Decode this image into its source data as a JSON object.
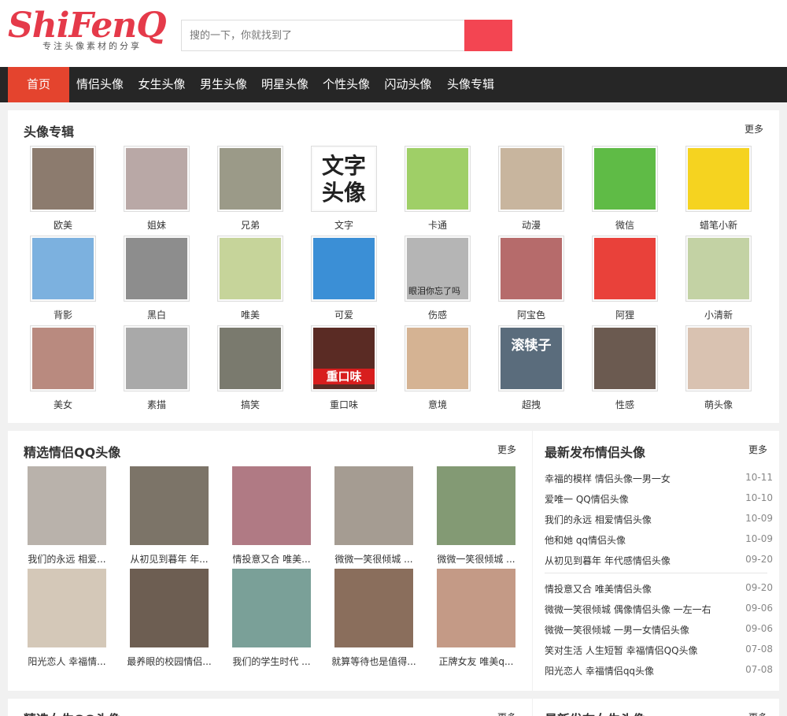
{
  "logo": {
    "text": "ShiFenQ",
    "tagline": "专注头像素材的分享"
  },
  "search": {
    "placeholder": "搜的一下，你就找到了"
  },
  "nav": [
    {
      "label": "首页",
      "active": true
    },
    {
      "label": "情侣头像"
    },
    {
      "label": "女生头像"
    },
    {
      "label": "男生头像"
    },
    {
      "label": "明星头像"
    },
    {
      "label": "个性头像"
    },
    {
      "label": "闪动头像"
    },
    {
      "label": "头像专辑"
    }
  ],
  "album": {
    "title": "头像专辑",
    "more": "更多",
    "items": [
      {
        "label": "欧美",
        "color": "#8c7b6e"
      },
      {
        "label": "姐妹",
        "color": "#b9a8a6"
      },
      {
        "label": "兄弟",
        "color": "#9b9a88"
      },
      {
        "label": "文字",
        "color": "#ffffff",
        "overlay": "文字头像"
      },
      {
        "label": "卡通",
        "color": "#9fcf67"
      },
      {
        "label": "动漫",
        "color": "#c8b59e"
      },
      {
        "label": "微信",
        "color": "#5fbb46"
      },
      {
        "label": "蜡笔小新",
        "color": "#f5d320"
      },
      {
        "label": "背影",
        "color": "#7cb1df"
      },
      {
        "label": "黑白",
        "color": "#8d8d8d"
      },
      {
        "label": "唯美",
        "color": "#c6d49a"
      },
      {
        "label": "可爱",
        "color": "#3b8fd6"
      },
      {
        "label": "伤感",
        "color": "#b5b5b5",
        "overlay": "眼泪你忘了吗"
      },
      {
        "label": "阿宝色",
        "color": "#b66b6b"
      },
      {
        "label": "阿狸",
        "color": "#e9413a"
      },
      {
        "label": "小清新",
        "color": "#c3d2a4"
      },
      {
        "label": "美女",
        "color": "#b98a7f"
      },
      {
        "label": "素描",
        "color": "#a9a9a9"
      },
      {
        "label": "搞笑",
        "color": "#7a7a6e"
      },
      {
        "label": "重口味",
        "color": "#5a2b24",
        "overlay": "重口味"
      },
      {
        "label": "意境",
        "color": "#d5b393"
      },
      {
        "label": "超拽",
        "color": "#5a6c7c",
        "overlay": "滚犊子"
      },
      {
        "label": "性感",
        "color": "#6b5a50"
      },
      {
        "label": "萌头像",
        "color": "#d9c2b1"
      }
    ]
  },
  "couples": {
    "title": "精选情侣QQ头像",
    "more": "更多",
    "items": [
      {
        "label": "我们的永远 相爱...",
        "color": "#b9b2ab"
      },
      {
        "label": "从初见到暮年 年...",
        "color": "#7c7468"
      },
      {
        "label": "情投意又合 唯美...",
        "color": "#b07a84"
      },
      {
        "label": "微微一笑很倾城 ...",
        "color": "#a59c92"
      },
      {
        "label": "微微一笑很倾城 ...",
        "color": "#839a74"
      },
      {
        "label": "阳光恋人 幸福情...",
        "color": "#d4c8b8"
      },
      {
        "label": "最养眼的校园情侣...",
        "color": "#6d5e52"
      },
      {
        "label": "我们的学生时代 ...",
        "color": "#7aa098"
      },
      {
        "label": "就算等待也是值得...",
        "color": "#8a6e5c"
      },
      {
        "label": "正牌女友 唯美q...",
        "color": "#c49a86"
      }
    ]
  },
  "latest": {
    "title": "最新发布情侣头像",
    "more": "更多",
    "items": [
      {
        "title": "幸福的模样 情侣头像一男一女",
        "date": "10-11"
      },
      {
        "title": "爱唯一 QQ情侣头像",
        "date": "10-10"
      },
      {
        "title": "我们的永远 相爱情侣头像",
        "date": "10-09"
      },
      {
        "title": "他和她 qq情侣头像",
        "date": "10-09"
      },
      {
        "title": "从初见到暮年 年代感情侣头像",
        "date": "09-20"
      },
      {
        "title": "情投意又合 唯美情侣头像",
        "date": "09-20"
      },
      {
        "title": "微微一笑很倾城 偶像情侣头像 一左一右",
        "date": "09-06"
      },
      {
        "title": "微微一笑很倾城 一男一女情侣头像",
        "date": "09-06"
      },
      {
        "title": "笑对生活 人生短暂 幸福情侣QQ头像",
        "date": "07-08"
      },
      {
        "title": "阳光恋人 幸福情侣qq头像",
        "date": "07-08"
      }
    ]
  },
  "next_section": {
    "left_title": "精选女生QQ头像",
    "right_title": "最新发布女生头像",
    "more": "更多"
  }
}
